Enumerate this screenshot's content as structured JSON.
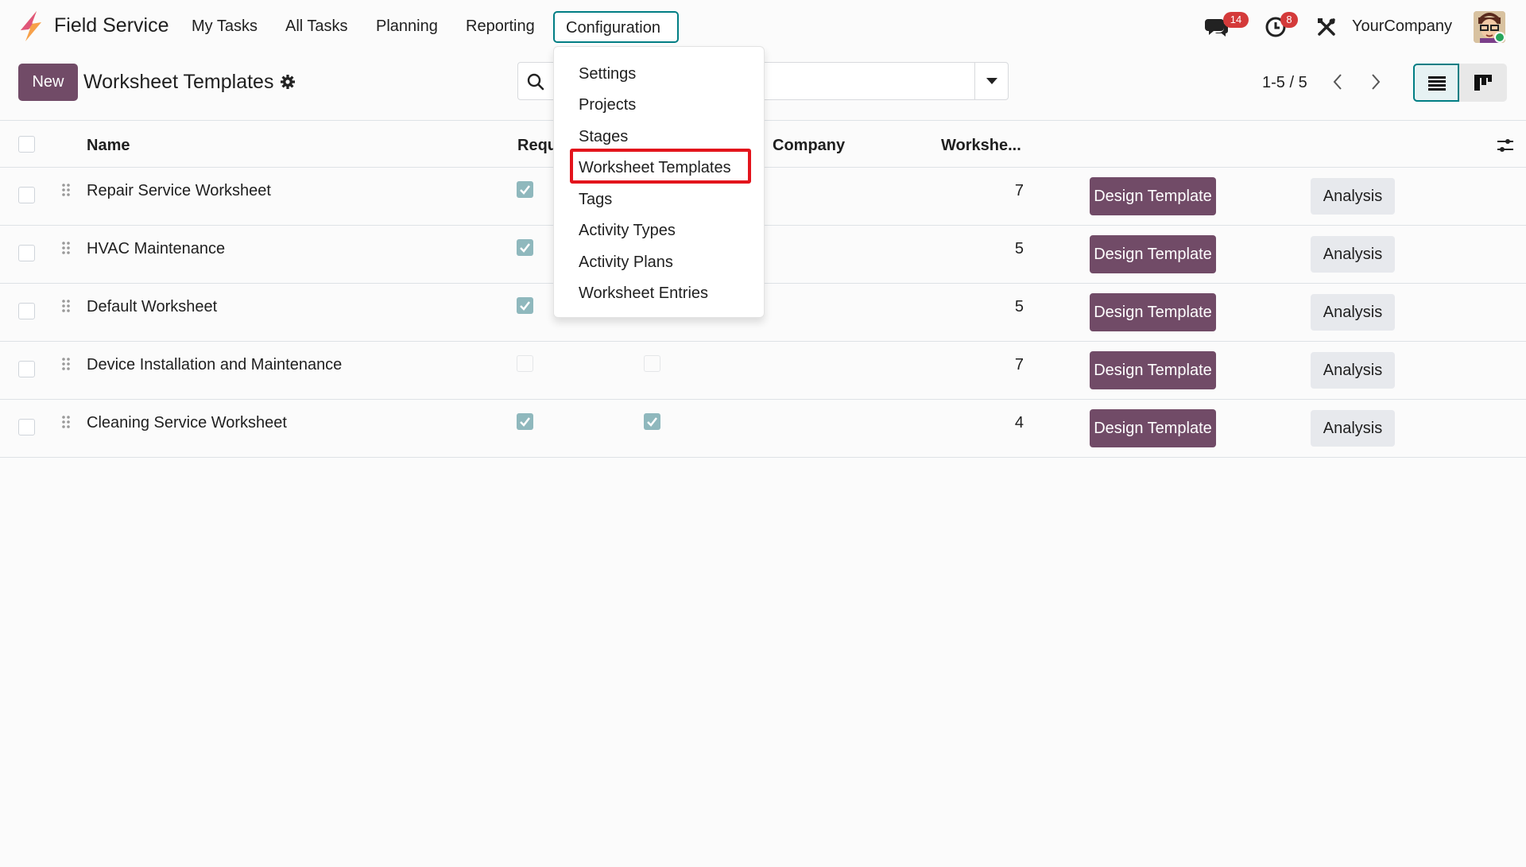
{
  "app": {
    "name": "Field Service",
    "company": "YourCompany",
    "brand_color": "#714b67",
    "accent_color": "#017e84"
  },
  "nav": {
    "items": [
      "My Tasks",
      "All Tasks",
      "Planning",
      "Reporting"
    ],
    "active": "Configuration"
  },
  "systray": {
    "messages_badge": "14",
    "activities_badge": "8"
  },
  "control_panel": {
    "new_label": "New",
    "title": "Worksheet Templates",
    "pager": "1-5 / 5"
  },
  "table": {
    "headers": {
      "name": "Name",
      "required": "Requ",
      "company": "Company",
      "worksheets": "Workshe..."
    },
    "rows": [
      {
        "name": "Repair Service Worksheet",
        "required": true,
        "col2": null,
        "worksheets": "7",
        "design": "Design Template",
        "analysis": "Analysis"
      },
      {
        "name": "HVAC Maintenance",
        "required": true,
        "col2": null,
        "worksheets": "5",
        "design": "Design Template",
        "analysis": "Analysis"
      },
      {
        "name": "Default Worksheet",
        "required": true,
        "col2": null,
        "worksheets": "5",
        "design": "Design Template",
        "analysis": "Analysis"
      },
      {
        "name": "Device Installation and Maintenance",
        "required": false,
        "col2": false,
        "worksheets": "7",
        "design": "Design Template",
        "analysis": "Analysis"
      },
      {
        "name": "Cleaning Service Worksheet",
        "required": true,
        "col2": true,
        "worksheets": "4",
        "design": "Design Template",
        "analysis": "Analysis"
      }
    ]
  },
  "config_menu": {
    "items": [
      "Settings",
      "Projects",
      "Stages",
      "Worksheet Templates",
      "Tags",
      "Activity Types",
      "Activity Plans",
      "Worksheet Entries"
    ],
    "highlighted": "Worksheet Templates",
    "highlight_color": "#e3141c"
  }
}
